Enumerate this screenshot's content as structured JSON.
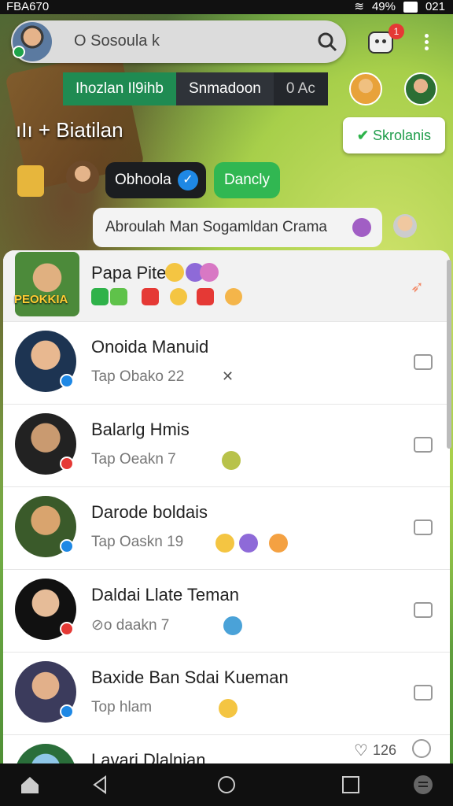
{
  "status_bar": {
    "left": "FBA670",
    "battery": "49%",
    "time": "021"
  },
  "topbar": {
    "search_text": "O Sosoula k",
    "notif_count": "1"
  },
  "tabs": [
    "Ihozlan Il9ihb",
    "Snmadoon",
    "0 Ac"
  ],
  "game": {
    "label": "ıIı + Biatilan",
    "select_button": "Skrolanis",
    "chip_dark": "Obhoola",
    "chip_green": "Dancly",
    "message": "Abroulah Man Sogamldan Crama"
  },
  "first_row": {
    "name": "Papa Pite",
    "badge": "PEOKKIA"
  },
  "contacts": [
    {
      "name": "Onoida Manuid",
      "sub": "Tap Obako 22",
      "status_color": "#1e88e5"
    },
    {
      "name": "Balarlg Hmis",
      "sub": "Tap Oeakn 7",
      "status_color": "#e53935"
    },
    {
      "name": "Darode boldais",
      "sub": "Tap Oaskn 19",
      "status_color": "#1e88e5"
    },
    {
      "name": "Daldai Llate Teman",
      "sub": "⊘o daakn 7",
      "status_color": "#e53935"
    },
    {
      "name": "Baxide Ban Sdai Kueman",
      "sub": "Top hlam",
      "status_color": "#1e88e5"
    },
    {
      "name": "Lavari Dlalnian",
      "sub": "",
      "status_color": "#1e88e5",
      "count": "126"
    }
  ],
  "nav": [
    "home",
    "back",
    "home-circle",
    "recents",
    "chat"
  ]
}
